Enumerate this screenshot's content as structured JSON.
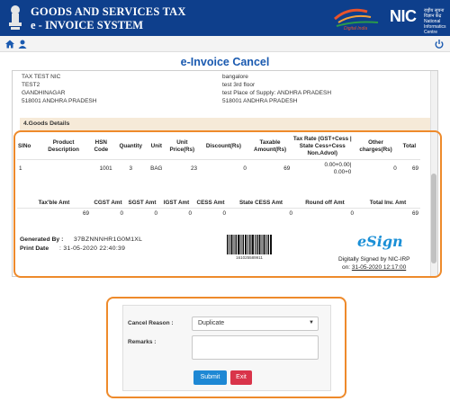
{
  "header": {
    "title_line1": "GOODS AND SERVICES TAX",
    "title_line2": "e - INVOICE SYSTEM",
    "nic_logo_text": "NIC",
    "nic_subtext": "राष्ट्रीय सूचना विज्ञान केंद्र National Informatics Centre"
  },
  "toolbar": {
    "icons": [
      "home-icon",
      "user-icon",
      "power-icon"
    ]
  },
  "page_title": "e-Invoice Cancel",
  "invoice": {
    "seller_address": [
      "TAX TEST NIC",
      "TEST2",
      "GANDHINAGAR",
      "518001    ANDHRA PRADESH"
    ],
    "buyer_address": [
      "bangalore",
      "test    3rd floor",
      "test Place of Supply: ANDHRA PRADESH",
      "518001    ANDHRA PRADESH"
    ],
    "section_title": "4.Goods Details",
    "goods_headers": [
      "SlNo",
      "Product Description",
      "HSN Code",
      "Quantity",
      "Unit",
      "Unit Price(Rs)",
      "Discount(Rs)",
      "Taxable Amount(Rs)",
      "Tax Rate (GST+Cess | State Cess+Cess Non.Advol)",
      "Other charges(Rs)",
      "Total"
    ],
    "goods_rows": [
      {
        "slno": "1",
        "desc": "",
        "hsn": "1001",
        "qty": "3",
        "unit": "BAG",
        "price": "23",
        "discount": "0",
        "taxable": "69",
        "rate_line1": "0.00+0.00|",
        "rate_line2": "0.00+0",
        "other": "0",
        "total": "69"
      }
    ],
    "totals_headers": [
      "Tax'ble Amt",
      "CGST Amt",
      "SGST Amt",
      "IGST Amt",
      "CESS Amt",
      "State CESS Amt",
      "Round off Amt",
      "Total Inv. Amt"
    ],
    "totals_row": [
      "69",
      "0",
      "0",
      "0",
      "0",
      "0",
      "0",
      "69"
    ],
    "generated_by_label": "Generated By :",
    "generated_by_value": "37BZNNNHR1G0M1XL",
    "print_date_label": "Print Date",
    "print_date_value": ":    31-05-2020 22:40:39",
    "barcode_number": "161025589911",
    "esign_logo": "eSign",
    "signed_by": "Digitally Signed by NIC-IRP",
    "signed_on_prefix": "on:",
    "signed_on_date": "31-05-2020 12:17:00"
  },
  "cancel_form": {
    "reason_label": "Cancel Reason :",
    "reason_value": "Duplicate",
    "remarks_label": "Remarks :",
    "remarks_value": "",
    "submit_label": "Submit",
    "exit_label": "Exit"
  },
  "colors": {
    "header_bg": "#0e3f8c",
    "title_blue": "#1a5ab0",
    "highlight_orange": "#ee8a2b",
    "submit_blue": "#1e88d4",
    "exit_red": "#d9344a",
    "goods_bar_bg": "#f6ead8"
  }
}
